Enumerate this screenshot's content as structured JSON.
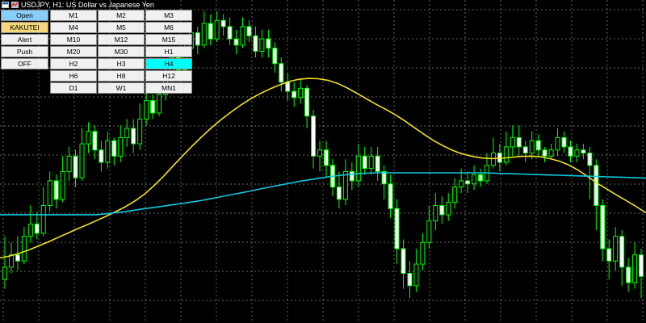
{
  "window": {
    "title": "USDJPY, H1:  US Dollar vs Japanese Yen",
    "icons": [
      "window-menu-icon",
      "indicator-icon"
    ]
  },
  "colors": {
    "background": "#000000",
    "grid": "#8c8c8c",
    "bull_candle": "#00ff00",
    "bear_candle_fill": "#ffffff",
    "ma_fast": "#f0e020",
    "ma_slow": "#10c8e0",
    "button_active_blue": "#87cefa",
    "button_gold": "#f5d77a",
    "button_selected_cyan": "#00ffff"
  },
  "control_buttons": [
    {
      "label": "Open",
      "state": "active"
    },
    {
      "label": "KAKUTEI",
      "state": "highlighted"
    },
    {
      "label": "Alert",
      "state": "normal"
    },
    {
      "label": "Push",
      "state": "normal"
    },
    {
      "label": "OFF",
      "state": "normal"
    }
  ],
  "timeframes": [
    [
      "M1",
      "M2",
      "M3"
    ],
    [
      "M4",
      "M5",
      "M6"
    ],
    [
      "M10",
      "M12",
      "M15"
    ],
    [
      "M20",
      "M30",
      "H1"
    ],
    [
      "H2",
      "H3",
      "H4"
    ],
    [
      "H6",
      "H8",
      "H12"
    ],
    [
      "D1",
      "W1",
      "MN1"
    ]
  ],
  "selected_timeframe": "H4",
  "chart_data": {
    "type": "candlestick",
    "price_scale_note": "no price or time axis labels are visible; values are in relative price units (0 = bottom, 100 = top of view)",
    "grid": true,
    "candles": [
      [
        12,
        16,
        26,
        9
      ],
      [
        16,
        20,
        24,
        14
      ],
      [
        20,
        18,
        26,
        15
      ],
      [
        18,
        26,
        29,
        17
      ],
      [
        26,
        30,
        36,
        24
      ],
      [
        30,
        27,
        34,
        25
      ],
      [
        27,
        36,
        42,
        26
      ],
      [
        36,
        44,
        47,
        34
      ],
      [
        44,
        38,
        46,
        35
      ],
      [
        38,
        47,
        52,
        37
      ],
      [
        47,
        52,
        55,
        44
      ],
      [
        52,
        45,
        54,
        42
      ],
      [
        45,
        56,
        61,
        44
      ],
      [
        56,
        60,
        63,
        53
      ],
      [
        60,
        54,
        62,
        51
      ],
      [
        54,
        50,
        57,
        47
      ],
      [
        50,
        57,
        60,
        48
      ],
      [
        57,
        52,
        58,
        49
      ],
      [
        52,
        58,
        62,
        50
      ],
      [
        58,
        61,
        64,
        55
      ],
      [
        61,
        56,
        64,
        53
      ],
      [
        56,
        64,
        69,
        54
      ],
      [
        64,
        70,
        74,
        62
      ],
      [
        70,
        66,
        72,
        64
      ],
      [
        66,
        72,
        76,
        65
      ],
      [
        72,
        78,
        81,
        70
      ],
      [
        78,
        84,
        87,
        76
      ],
      [
        84,
        80,
        86,
        78
      ],
      [
        80,
        87,
        90,
        78
      ],
      [
        87,
        92,
        95,
        86
      ],
      [
        92,
        88,
        94,
        85
      ],
      [
        88,
        95,
        99,
        87
      ],
      [
        95,
        90,
        98,
        88
      ],
      [
        90,
        96,
        99,
        89
      ],
      [
        96,
        94,
        98,
        91
      ],
      [
        94,
        90,
        97,
        88
      ],
      [
        90,
        88,
        93,
        85
      ],
      [
        88,
        94,
        97,
        87
      ],
      [
        94,
        91,
        96,
        89
      ],
      [
        91,
        86,
        94,
        84
      ],
      [
        86,
        90,
        93,
        84
      ],
      [
        90,
        87,
        93,
        84
      ],
      [
        87,
        82,
        89,
        79
      ],
      [
        82,
        76,
        84,
        73
      ],
      [
        76,
        73,
        79,
        70
      ],
      [
        73,
        71,
        76,
        68
      ],
      [
        71,
        74,
        77,
        69
      ],
      [
        74,
        65,
        75,
        61
      ],
      [
        65,
        52,
        67,
        48
      ],
      [
        52,
        54,
        57,
        47
      ],
      [
        54,
        49,
        57,
        45
      ],
      [
        49,
        42,
        51,
        39
      ],
      [
        42,
        38,
        47,
        35
      ],
      [
        38,
        47,
        51,
        36
      ],
      [
        47,
        44,
        50,
        41
      ],
      [
        44,
        52,
        56,
        42
      ],
      [
        52,
        48,
        55,
        46
      ],
      [
        48,
        52,
        55,
        46
      ],
      [
        52,
        47,
        55,
        44
      ],
      [
        47,
        43,
        49,
        38
      ],
      [
        43,
        35,
        46,
        32
      ],
      [
        35,
        22,
        38,
        17
      ],
      [
        22,
        14,
        25,
        9
      ],
      [
        14,
        10,
        18,
        6
      ],
      [
        10,
        17,
        22,
        8
      ],
      [
        17,
        24,
        27,
        15
      ],
      [
        24,
        31,
        36,
        22
      ],
      [
        31,
        36,
        40,
        28
      ],
      [
        36,
        33,
        39,
        30
      ],
      [
        33,
        37,
        40,
        31
      ],
      [
        37,
        42,
        45,
        35
      ],
      [
        42,
        44,
        48,
        40
      ],
      [
        44,
        43,
        47,
        40
      ],
      [
        43,
        46,
        49,
        41
      ],
      [
        46,
        44,
        48,
        42
      ],
      [
        44,
        49,
        53,
        43
      ],
      [
        49,
        53,
        58,
        48
      ],
      [
        53,
        50,
        56,
        47
      ],
      [
        50,
        55,
        60,
        49
      ],
      [
        55,
        58,
        62,
        52
      ],
      [
        58,
        55,
        62,
        52
      ],
      [
        55,
        53,
        57,
        50
      ],
      [
        53,
        57,
        60,
        51
      ],
      [
        57,
        54,
        59,
        52
      ],
      [
        54,
        52,
        55,
        50
      ],
      [
        52,
        54,
        56,
        51
      ],
      [
        54,
        58,
        61,
        52
      ],
      [
        58,
        55,
        60,
        53
      ],
      [
        55,
        52,
        57,
        50
      ],
      [
        52,
        54,
        56,
        50
      ],
      [
        54,
        53,
        56,
        51
      ],
      [
        53,
        49,
        55,
        38
      ],
      [
        49,
        36,
        51,
        28
      ],
      [
        36,
        22,
        38,
        18
      ],
      [
        22,
        18,
        25,
        12
      ],
      [
        18,
        26,
        29,
        15
      ],
      [
        26,
        16,
        28,
        10
      ],
      [
        16,
        11,
        19,
        8
      ],
      [
        11,
        20,
        24,
        9
      ],
      [
        20,
        13,
        22,
        6
      ]
    ],
    "series": [
      {
        "name": "MA",
        "color": "#f0e020",
        "values": [
          19,
          19.6,
          20.5,
          21.6,
          22.9,
          24.2,
          25.6,
          27,
          28.4,
          29.7,
          31.1,
          32.5,
          34,
          35.6,
          37.5,
          39.7,
          42.5,
          45.6,
          49,
          52.3,
          55.5,
          58.5,
          61.4,
          64,
          66.4,
          68.6,
          70.6,
          72.3,
          73.8,
          75.1,
          76.2,
          76.9,
          77.2,
          77.1,
          76.6,
          75.6,
          74.1,
          72.4,
          70.6,
          68.8,
          67.2,
          65.4,
          63.4,
          61.2,
          59,
          57,
          55.3,
          53.8,
          52.7,
          51.9,
          51.4,
          51.2,
          51.3,
          51.6,
          51.9,
          52,
          51.8,
          51.2,
          50.4,
          49.1,
          47.4,
          45.3,
          43.1,
          41.2,
          39.3,
          37.5,
          35.6,
          33.6
        ]
      },
      {
        "name": "MA",
        "color": "#10c8e0",
        "values": [
          33,
          33,
          33,
          33,
          33,
          33,
          33,
          33,
          33,
          33,
          33,
          33.3,
          33.7,
          34,
          34.5,
          35,
          35.4,
          35.8,
          36.3,
          36.7,
          37.2,
          37.7,
          38.3,
          38.9,
          39.5,
          40.1,
          40.7,
          41.4,
          42,
          42.6,
          43.2,
          43.8,
          44.3,
          44.8,
          45.3,
          45.7,
          46,
          46.3,
          46.5,
          46.6,
          46.6,
          46.6,
          46.6,
          46.6,
          46.6,
          46.6,
          46.6,
          46.6,
          46.6,
          46.6,
          46.6,
          46.5,
          46.4,
          46.3,
          46.2,
          46.1,
          46,
          45.9,
          45.8,
          45.7,
          45.6,
          45.5,
          45.4,
          45.3,
          45.2,
          45.1,
          45,
          44.9
        ]
      }
    ]
  }
}
